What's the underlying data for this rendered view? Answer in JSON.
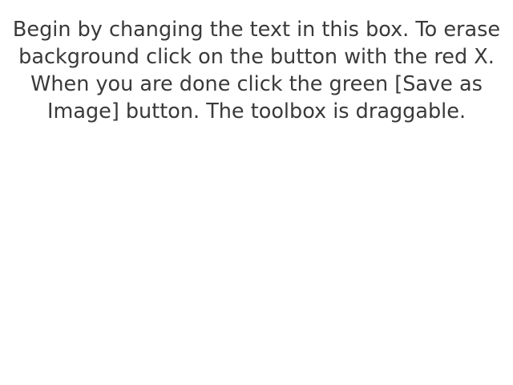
{
  "editor": {
    "text": "Begin by changing the text in this box. To erase background click on the button with the red X. When you are done click the green [Save as Image] button. The toolbox is draggable."
  },
  "colors": {
    "background": "#ffffff",
    "text": "#3a3a3a"
  }
}
